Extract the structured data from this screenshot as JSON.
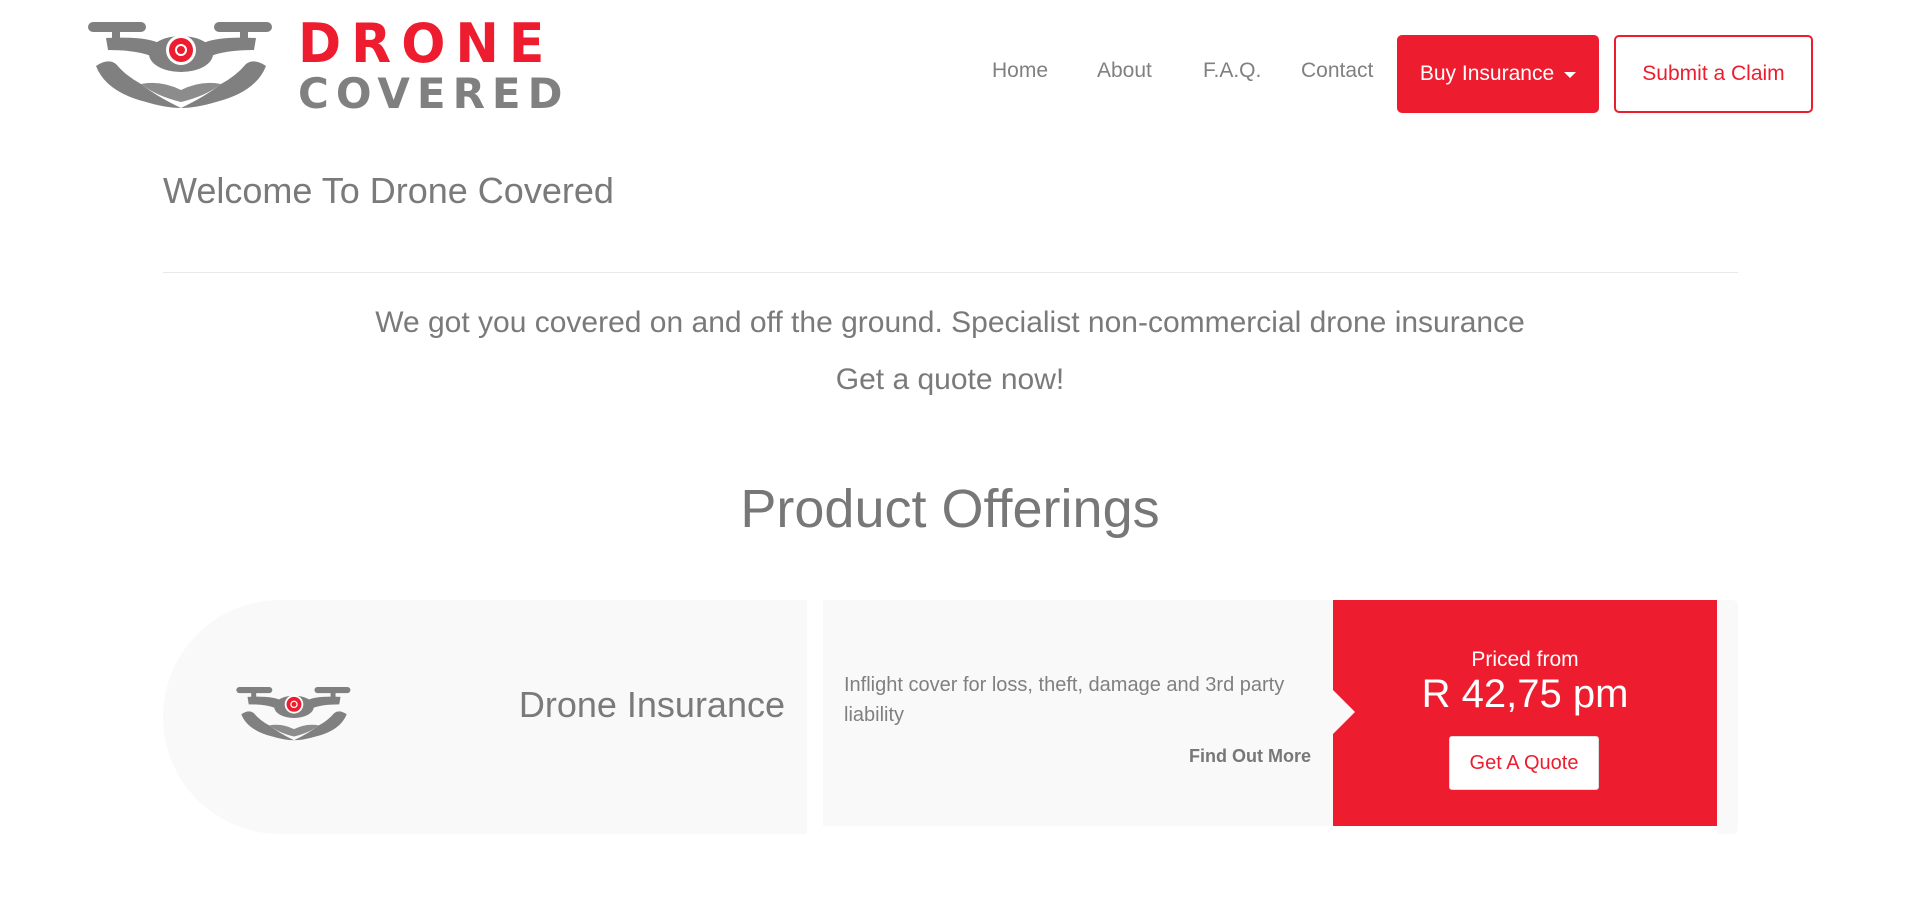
{
  "brand": {
    "name_line1": "DRONE",
    "name_line2": "COVERED",
    "accent_color": "#ed1c2e",
    "grey_color": "#808080"
  },
  "nav": {
    "items": [
      {
        "label": "Home"
      },
      {
        "label": "About"
      },
      {
        "label": "F.A.Q."
      },
      {
        "label": "Contact"
      }
    ],
    "buy_label": "Buy Insurance",
    "claim_label": "Submit a Claim"
  },
  "welcome": {
    "title": "Welcome To Drone Covered",
    "tagline": "We got you covered on and off the ground. Specialist non-commercial drone insurance",
    "cta": "Get a quote now!"
  },
  "products": {
    "section_title": "Product Offerings",
    "items": [
      {
        "name": "Drone Insurance",
        "icon": "drone-hands-icon",
        "description": "Inflight cover for loss, theft, damage and 3rd party liability",
        "find_more_label": "Find Out More",
        "priced_from_label": "Priced from",
        "price": "R 42,75 pm",
        "quote_label": "Get A Quote"
      }
    ]
  }
}
